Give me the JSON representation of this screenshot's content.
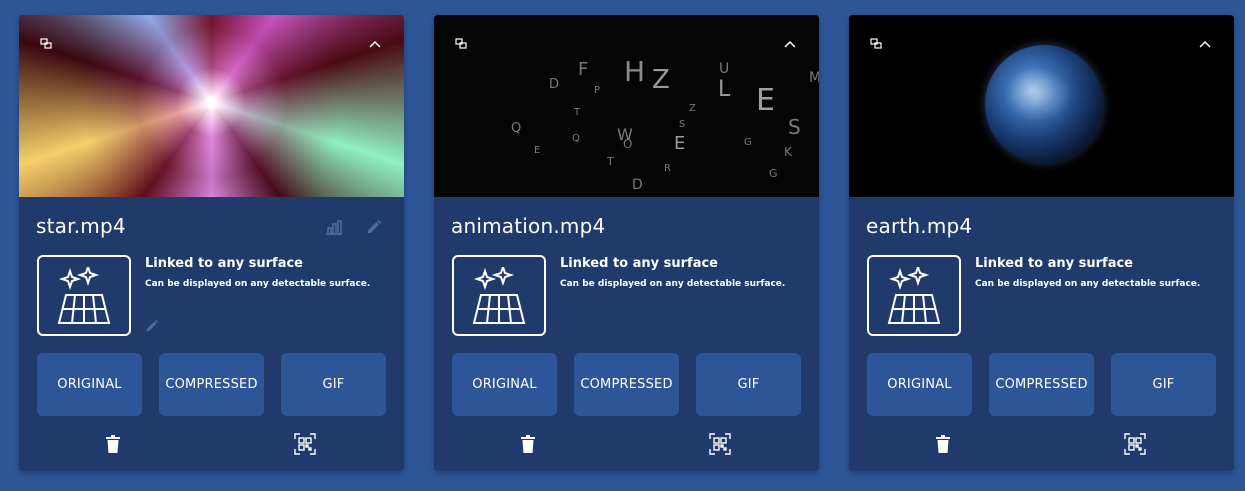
{
  "cards": [
    {
      "title": "star.mp4",
      "thumbnail": "star-burst-video",
      "surface": {
        "title": "Linked to any surface",
        "desc": "Can be displayed on any detectable surface."
      },
      "buttons": [
        "ORIGINAL",
        "COMPRESSED",
        "GIF"
      ],
      "tools": [
        "analytics-icon",
        "edit-icon"
      ],
      "show_small_edit": true
    },
    {
      "title": "animation.mp4",
      "thumbnail": "falling-letters-video",
      "letters": [
        "H",
        "Z",
        "F",
        "D",
        "U",
        "L",
        "E",
        "M",
        "Q",
        "S",
        "W",
        "O",
        "E",
        "K",
        "T",
        "G",
        "D",
        "Q",
        "P",
        "S",
        "Z",
        "G",
        "E",
        "T",
        "R"
      ],
      "surface": {
        "title": "Linked to any surface",
        "desc": "Can be displayed on any detectable surface."
      },
      "buttons": [
        "ORIGINAL",
        "COMPRESSED",
        "GIF"
      ]
    },
    {
      "title": "earth.mp4",
      "thumbnail": "earth-globe-video",
      "surface": {
        "title": "Linked to any surface",
        "desc": "Can be displayed on any detectable surface."
      },
      "buttons": [
        "ORIGINAL",
        "COMPRESSED",
        "GIF"
      ]
    }
  ],
  "colors": {
    "page_bg": "#2d5597",
    "card_bg": "#1f3a6b",
    "button_bg": "#2d5597",
    "muted_icon": "#4e6d9f"
  }
}
